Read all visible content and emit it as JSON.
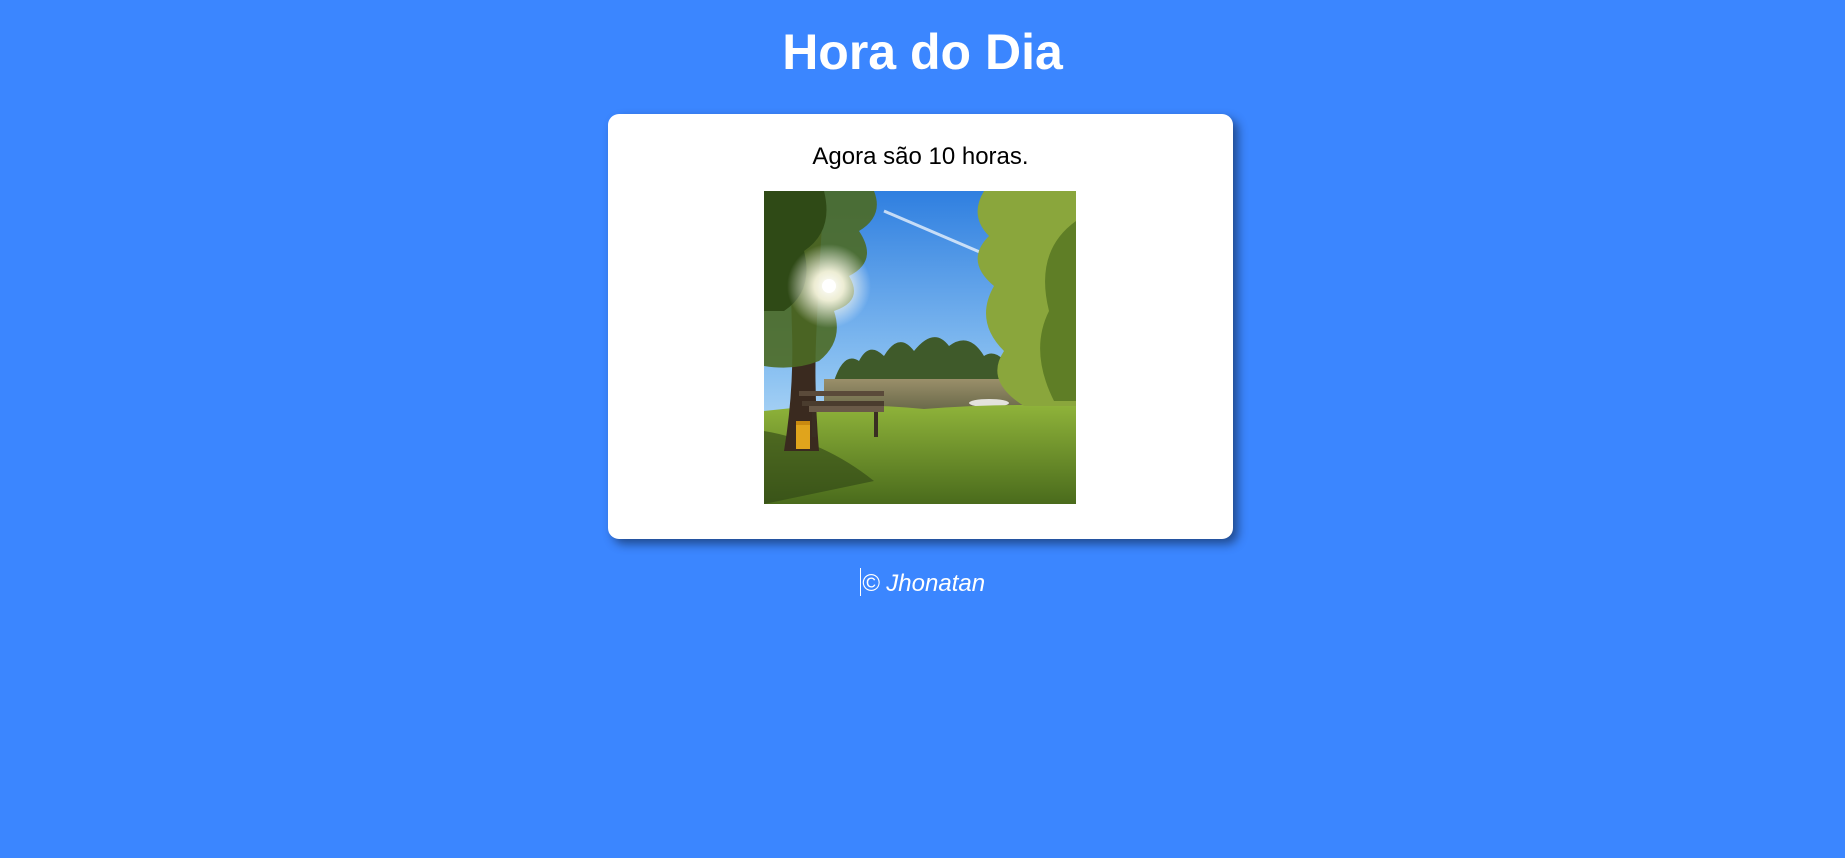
{
  "page": {
    "title": "Hora do Dia",
    "background_color": "#3b86ff"
  },
  "card": {
    "message": "Agora são 10 horas.",
    "image": {
      "subject": "sunlit park with bench and lake",
      "name": "morning-park-image"
    }
  },
  "footer": {
    "copyright_symbol": "©",
    "author": "Jhonatan"
  }
}
